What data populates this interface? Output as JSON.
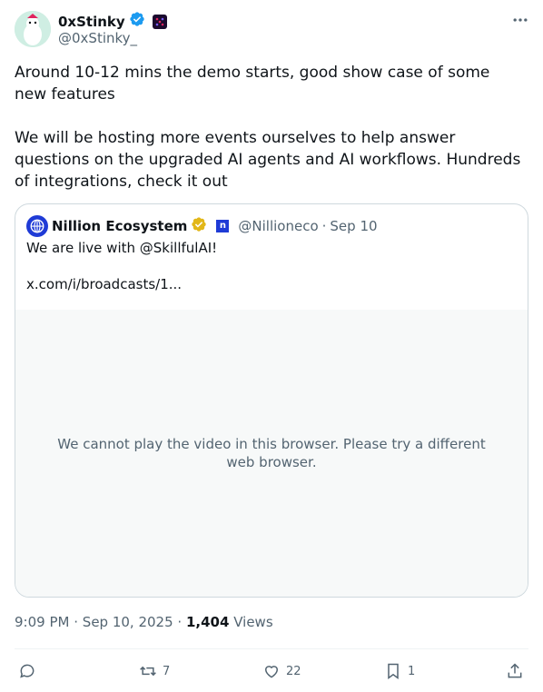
{
  "author": {
    "name": "0xStinky",
    "handle": "@0xStinky_",
    "verified": true
  },
  "tweet": {
    "text": "Around 10-12 mins the demo starts, good show case of some new features\n\nWe will be hosting more events ourselves to help answer questions on the upgraded AI agents and AI workflows. Hundreds of integrations, check it out"
  },
  "quoted": {
    "name": "Nillion Ecosystem",
    "handle": "@Nillioneco",
    "separator": "·",
    "date": "Sep 10",
    "text": "We are live with @SkillfulAI!\n\nx.com/i/broadcasts/1...",
    "video_message": "We cannot play the video in this browser. Please try a different web browser.",
    "badge_color": "#e2b719",
    "affiliate_badge_text": "n"
  },
  "meta": {
    "time": "9:09 PM",
    "separator": "·",
    "date": "Sep 10, 2025",
    "views_count": "1,404",
    "views_label": "Views"
  },
  "actions": {
    "reply_count": "",
    "retweet_count": "7",
    "like_count": "22",
    "bookmark_count": "1"
  },
  "colors": {
    "verified_blue": "#1d9bf0",
    "text_secondary": "#536471",
    "border": "#cfd9de"
  }
}
